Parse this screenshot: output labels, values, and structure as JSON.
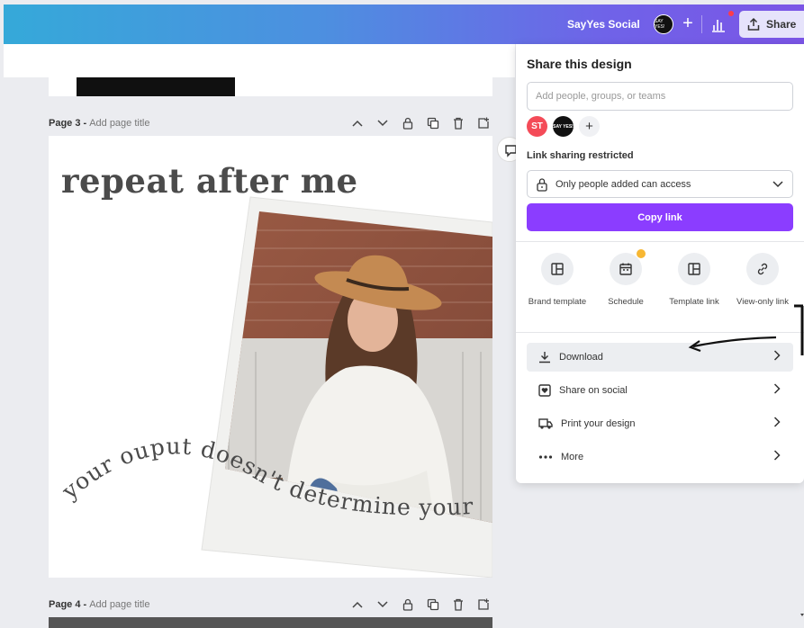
{
  "topbar": {
    "brand_name": "SayYes Social",
    "avatar_text": "SAY YES!",
    "add_label": "+",
    "share_label": "Share"
  },
  "pages": [
    {
      "number": "Page 3 -",
      "title_placeholder": "Add page title"
    },
    {
      "number": "Page 4 -",
      "title_placeholder": "Add page title"
    }
  ],
  "design": {
    "headline": "repeat after me",
    "curved_text": "your ouput doesn't determine your worth"
  },
  "share_panel": {
    "title": "Share this design",
    "people_placeholder": "Add people, groups, or teams",
    "collaborators": [
      {
        "initials": "ST"
      },
      {
        "initials": "SAY YES!"
      },
      {
        "initials": "+"
      }
    ],
    "link_sharing_label": "Link sharing restricted",
    "access_option": "Only people added can access",
    "copy_link_label": "Copy link",
    "options": [
      {
        "label": "Brand template",
        "icon": "layout-icon"
      },
      {
        "label": "Schedule",
        "icon": "calendar-icon"
      },
      {
        "label": "Template link",
        "icon": "layout-icon"
      },
      {
        "label": "View-only link",
        "icon": "link-icon"
      }
    ],
    "actions": [
      {
        "label": "Download",
        "icon": "download-icon"
      },
      {
        "label": "Share on social",
        "icon": "heart-icon"
      },
      {
        "label": "Print your design",
        "icon": "truck-icon"
      },
      {
        "label": "More",
        "icon": "more-dots-icon"
      }
    ]
  },
  "colors": {
    "accent": "#8b3dff",
    "topbar_gradient_start": "#35a9d9",
    "topbar_gradient_end": "#7b55e6"
  }
}
